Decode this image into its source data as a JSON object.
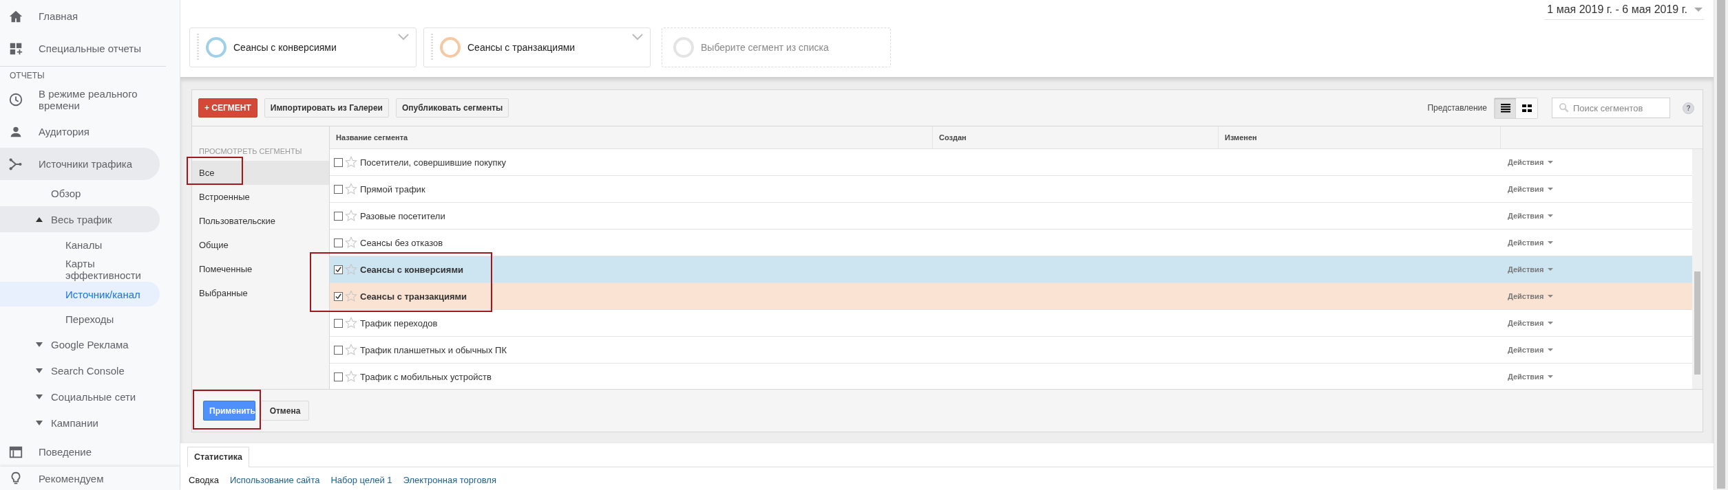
{
  "sidebar": {
    "items": [
      {
        "label": "Главная",
        "selected": false
      },
      {
        "label": "Специальные отчеты",
        "selected": false
      }
    ],
    "section_label": "ОТЧЕТЫ",
    "report_items": [
      {
        "label": "В режиме реального времени",
        "selected": false
      },
      {
        "label": "Аудитория",
        "selected": false
      },
      {
        "label": "Источники трафика",
        "selected": false,
        "expanded": true,
        "children": [
          {
            "label": "Обзор",
            "selected": false
          },
          {
            "label": "Весь трафик",
            "selected": false,
            "expanded": true,
            "children": [
              {
                "label": "Каналы",
                "selected": false
              },
              {
                "label": "Карты эффективности",
                "selected": false
              },
              {
                "label": "Источник/канал",
                "selected": true
              },
              {
                "label": "Переходы",
                "selected": false
              }
            ]
          },
          {
            "label": "Google Реклама",
            "selected": false,
            "expanded": false
          },
          {
            "label": "Search Console",
            "selected": false,
            "expanded": false
          },
          {
            "label": "Социальные сети",
            "selected": false,
            "expanded": false
          },
          {
            "label": "Кампании",
            "selected": false,
            "expanded": false
          }
        ]
      },
      {
        "label": "Поведение",
        "selected": false
      }
    ],
    "footer_item": {
      "label": "Рекомендуем",
      "selected": false
    }
  },
  "date_range": "1 мая 2019 г. - 6 мая 2019 г.",
  "segments": [
    {
      "kind": "segment",
      "label": "Сеансы с конверсиями",
      "color": "#9fd0e8"
    },
    {
      "kind": "segment",
      "label": "Сеансы с транзакциями",
      "color": "#f4c9a3"
    },
    {
      "kind": "empty",
      "label": "Выберите сегмент из списка"
    }
  ],
  "segment_panel": {
    "toolbar_buttons": [
      {
        "kind": "primary",
        "label": "+ СЕГМЕНТ"
      },
      {
        "kind": "default",
        "label": "Импортировать из Галереи"
      },
      {
        "kind": "default",
        "label": "Опубликовать сегменты"
      }
    ],
    "view_label": "Представление",
    "view_options": [
      {
        "selected": true
      },
      {
        "selected": false
      }
    ],
    "search": {
      "placeholder": "Поиск сегментов"
    },
    "help": "?",
    "filter_title": "ПРОСМОТРЕТЬ СЕГМЕНТЫ",
    "filters": [
      {
        "label": "Все",
        "selected": true,
        "highlighted": true
      },
      {
        "label": "Встроенные",
        "selected": false,
        "highlighted": false
      },
      {
        "label": "Пользовательские",
        "selected": false,
        "highlighted": false
      },
      {
        "label": "Общие",
        "selected": false,
        "highlighted": false
      },
      {
        "label": "Помеченные",
        "selected": false,
        "highlighted": false
      },
      {
        "label": "Выбранные",
        "selected": false,
        "highlighted": false
      }
    ],
    "table": {
      "columns": [
        "Название сегмента",
        "Создан",
        "Изменен"
      ],
      "rows": [
        {
          "name": "Посетители, совершившие покупку",
          "checked": false,
          "starred": false,
          "highlighted": false,
          "actions": "Действия"
        },
        {
          "name": "Прямой трафик",
          "checked": false,
          "starred": false,
          "highlighted": false,
          "actions": "Действия"
        },
        {
          "name": "Разовые посетители",
          "checked": false,
          "starred": false,
          "highlighted": false,
          "actions": "Действия"
        },
        {
          "name": "Сеансы без отказов",
          "checked": false,
          "starred": false,
          "highlighted": false,
          "actions": "Действия"
        },
        {
          "name": "Сеансы с конверсиями",
          "checked": true,
          "starred": false,
          "highlighted": true,
          "color": "#cde4f1",
          "actions": "Действия"
        },
        {
          "name": "Сеансы с транзакциями",
          "checked": true,
          "starred": false,
          "highlighted": true,
          "color": "#fae3d3",
          "actions": "Действия"
        },
        {
          "name": "Трафик переходов",
          "checked": false,
          "starred": false,
          "highlighted": false,
          "actions": "Действия"
        },
        {
          "name": "Трафик планшетных и обычных ПК",
          "checked": false,
          "starred": false,
          "highlighted": false,
          "actions": "Действия"
        },
        {
          "name": "Трафик с мобильных устройств",
          "checked": false,
          "starred": false,
          "highlighted": false,
          "actions": "Действия"
        }
      ]
    },
    "footer_buttons": [
      {
        "kind": "primary",
        "label": "Применить",
        "highlighted": true
      },
      {
        "kind": "default",
        "label": "Отмена",
        "highlighted": false
      }
    ]
  },
  "report_tabs": [
    {
      "label": "Статистика",
      "selected": true
    }
  ],
  "report_links": [
    {
      "label": "Сводка",
      "selected": true
    },
    {
      "label": "Использование сайта",
      "selected": false
    },
    {
      "label": "Набор целей 1",
      "selected": false
    },
    {
      "label": "Электронная торговля",
      "selected": false
    }
  ]
}
